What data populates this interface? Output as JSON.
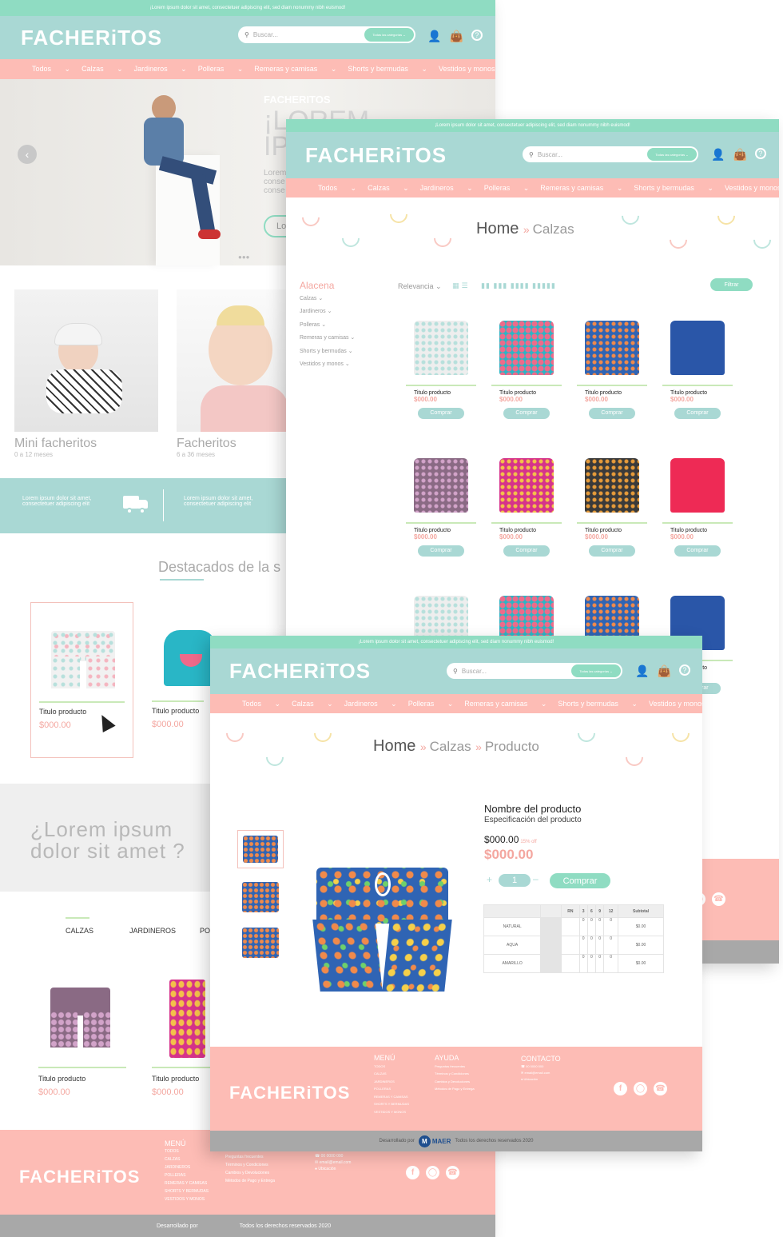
{
  "topbar": "¡Lorem ipsum dolor sit amet, consectetuer adipiscing elit, sed diam nonummy nibh euismod!",
  "brand": "FACHERiTOS",
  "search_placeholder": "Buscar...",
  "category_select": "Todas las categorías",
  "nav": [
    "Todos",
    "Calzas",
    "Jardineros",
    "Polleras",
    "Remeras y camisas",
    "Shorts y bermudas",
    "Vestidos y monos"
  ],
  "home": {
    "hero": {
      "brand": "FACHERITOS",
      "title": "¡LOREM IP",
      "text": "Lorem conse conse",
      "button": "Lo"
    },
    "categories": [
      {
        "title": "Mini facheritos",
        "sub": "0 a 12 meses"
      },
      {
        "title": "Facheritos",
        "sub": "6 a 36 meses"
      }
    ],
    "benefits": [
      "Lorem ipsum dolor sit amet, consectetuer adipiscing elit",
      "Lorem ipsum dolor sit amet, consectetuer adipiscing elit"
    ],
    "featured_title": "Destacados de la s",
    "featured": [
      {
        "title": "Titulo producto",
        "price": "$000.00"
      },
      {
        "title": "Titulo producto",
        "price": "$000.00"
      }
    ],
    "question": "¿Lorem ipsum dolor sit amet ?",
    "tabs": [
      "CALZAS",
      "JARDINEROS",
      "PO"
    ],
    "tab_products": [
      {
        "title": "Titulo producto",
        "price": "$000.00"
      },
      {
        "title": "Titulo producto",
        "price": "$000.00"
      }
    ],
    "footer": {
      "menu_title": "MENÚ",
      "menu": [
        "TODOS",
        "CALZAS",
        "JARDINEROS",
        "POLLERAS",
        "REMERAS Y CAMISAS",
        "SHORTS Y BERMUDAS",
        "VESTIDOS Y MONOS"
      ],
      "help": [
        "Preguntas frecuentes",
        "Términos y Condiciones",
        "Cambios y Devoluciones",
        "Métodos de Pago y Entrega"
      ],
      "contact": [
        "00 0000 000",
        "email@email.com",
        "Ubicación"
      ],
      "dev": "Desarrollado por",
      "rights": "Todos los derechos reservados 2020"
    }
  },
  "listing": {
    "breadcrumb": [
      "Home",
      "Calzas"
    ],
    "sidebar_title": "Alacena",
    "sidebar": [
      "Calzas",
      "Jardineros",
      "Polleras",
      "Remeras y camisas",
      "Shorts y bermudas",
      "Vestidos y monos"
    ],
    "sort": "Relevancia",
    "filter": "Filtrar",
    "product_title": "Titulo producto",
    "product_price": "$000.00",
    "buy": "Comprar"
  },
  "product": {
    "breadcrumb": [
      "Home",
      "Calzas",
      "Producto"
    ],
    "name": "Nombre del producto",
    "spec": "Especificación del producto",
    "old_price": "$000.00",
    "discount": "15% off",
    "price": "$000.00",
    "qty": "1",
    "buy": "Comprar",
    "table_head": [
      "RN",
      "3",
      "6",
      "9",
      "12",
      "Subtotal"
    ],
    "table_rows": [
      {
        "name": "NATURAL",
        "vals": [
          "0",
          "0",
          "0",
          "0"
        ],
        "sub": "$0.00"
      },
      {
        "name": "AQUA",
        "vals": [
          "0",
          "0",
          "0",
          "0"
        ],
        "sub": "$0.00"
      },
      {
        "name": "AMARILLO",
        "vals": [
          "0",
          "0",
          "0",
          "0"
        ],
        "sub": "$0.00"
      }
    ],
    "footer": {
      "menu_title": "MENÚ",
      "help_title": "AYUDA",
      "contact_title": "CONTACTO",
      "dev": "Desarrollado por",
      "maer": "MAER",
      "rights": "Todos los derechos reservados 2020"
    }
  },
  "colors": {
    "mint": "#8fdcc2",
    "teal": "#a9d8d4",
    "pink": "#fdbcb5",
    "price": "#f4a7a0",
    "gray": "#a8a8a8"
  }
}
